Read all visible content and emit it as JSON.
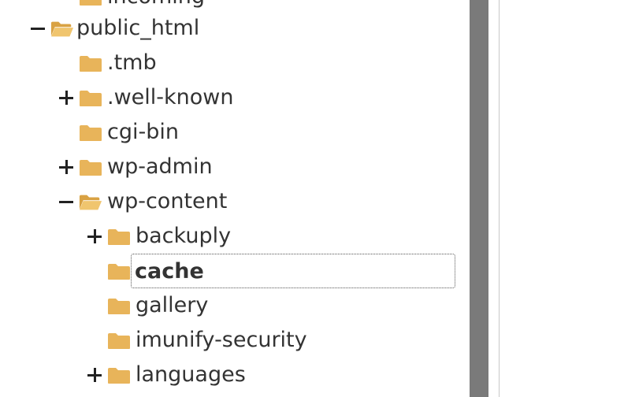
{
  "tree": {
    "items": [
      {
        "label": "incoming",
        "state": "closed",
        "toggle": "none"
      },
      {
        "label": "public_html",
        "state": "open",
        "toggle": "minus"
      },
      {
        "label": ".tmb",
        "state": "closed",
        "toggle": "none"
      },
      {
        "label": ".well-known",
        "state": "closed",
        "toggle": "plus"
      },
      {
        "label": "cgi-bin",
        "state": "closed",
        "toggle": "none"
      },
      {
        "label": "wp-admin",
        "state": "closed",
        "toggle": "plus"
      },
      {
        "label": "wp-content",
        "state": "open",
        "toggle": "minus"
      },
      {
        "label": "backuply",
        "state": "closed",
        "toggle": "plus"
      },
      {
        "label": "cache",
        "state": "closed",
        "toggle": "none",
        "selected": true
      },
      {
        "label": "gallery",
        "state": "closed",
        "toggle": "none"
      },
      {
        "label": "imunify-security",
        "state": "closed",
        "toggle": "none"
      },
      {
        "label": "languages",
        "state": "closed",
        "toggle": "plus"
      }
    ]
  },
  "colors": {
    "folder": "#e8b45a",
    "folder_dark": "#d9a243",
    "scrollbar": "#7a7a7a",
    "text": "#333333"
  }
}
